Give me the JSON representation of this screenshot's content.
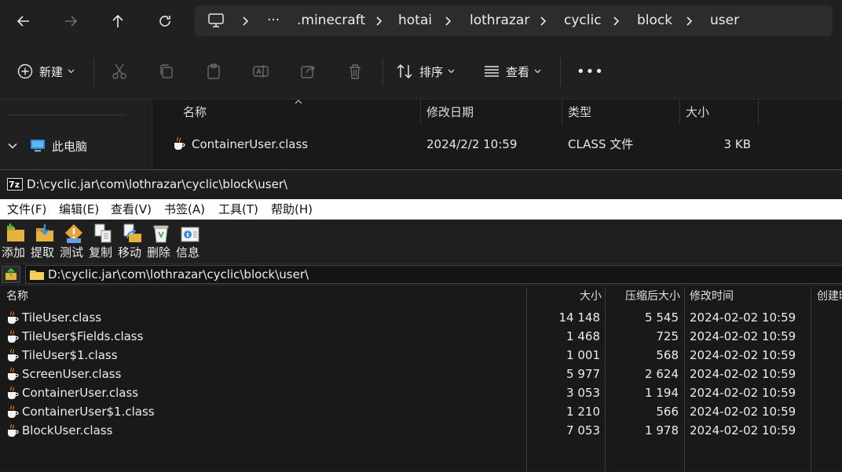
{
  "explorer": {
    "breadcrumb": [
      ".minecraft",
      "hotai",
      "lothrazar",
      "cyclic",
      "block",
      "user"
    ],
    "overflow_label": "···",
    "toolbar": {
      "new_label": "新建",
      "sort_label": "排序",
      "view_label": "查看",
      "more_label": "•••"
    },
    "nav_pane": {
      "this_pc_label": "此电脑"
    },
    "columns": {
      "name": "名称",
      "modified": "修改日期",
      "type": "类型",
      "size": "大小"
    },
    "files": [
      {
        "name": "ContainerUser.class",
        "modified": "2024/2/2 10:59",
        "type": "CLASS 文件",
        "size": "3 KB"
      }
    ]
  },
  "sevenzip": {
    "title": "D:\\cyclic.jar\\com\\lothrazar\\cyclic\\block\\user\\",
    "menu": [
      "文件(F)",
      "编辑(E)",
      "查看(V)",
      "书签(A)",
      "工具(T)",
      "帮助(H)"
    ],
    "toolbar": [
      "添加",
      "提取",
      "测试",
      "复制",
      "移动",
      "删除",
      "信息"
    ],
    "path": "D:\\cyclic.jar\\com\\lothrazar\\cyclic\\block\\user\\",
    "columns": {
      "name": "名称",
      "size": "大小",
      "packed": "压缩后大小",
      "modified": "修改时间",
      "created": "创建时"
    },
    "rows": [
      {
        "name": "TileUser.class",
        "size": "14 148",
        "packed": "5 545",
        "modified": "2024-02-02 10:59"
      },
      {
        "name": "TileUser$Fields.class",
        "size": "1 468",
        "packed": "725",
        "modified": "2024-02-02 10:59"
      },
      {
        "name": "TileUser$1.class",
        "size": "1 001",
        "packed": "568",
        "modified": "2024-02-02 10:59"
      },
      {
        "name": "ScreenUser.class",
        "size": "5 977",
        "packed": "2 624",
        "modified": "2024-02-02 10:59"
      },
      {
        "name": "ContainerUser.class",
        "size": "3 053",
        "packed": "1 194",
        "modified": "2024-02-02 10:59"
      },
      {
        "name": "ContainerUser$1.class",
        "size": "1 210",
        "packed": "566",
        "modified": "2024-02-02 10:59"
      },
      {
        "name": "BlockUser.class",
        "size": "7 053",
        "packed": "1 978",
        "modified": "2024-02-02 10:59"
      }
    ]
  }
}
